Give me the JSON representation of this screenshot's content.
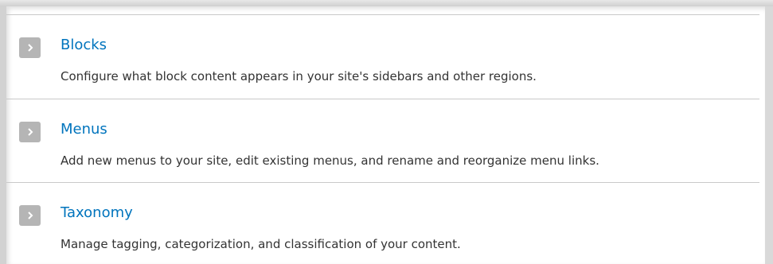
{
  "items": [
    {
      "title": "Blocks",
      "description": "Configure what block content appears in your site's sidebars and other regions.",
      "icon": "chevron-right-icon"
    },
    {
      "title": "Menus",
      "description": "Add new menus to your site, edit existing menus, and rename and reorganize menu links.",
      "icon": "chevron-right-icon"
    },
    {
      "title": "Taxonomy",
      "description": "Manage tagging, categorization, and classification of your content.",
      "icon": "chevron-right-icon"
    }
  ],
  "colors": {
    "link": "#0074bd",
    "text": "#333333",
    "icon_bg": "#b5b5b5",
    "divider": "#c9c9c9"
  }
}
